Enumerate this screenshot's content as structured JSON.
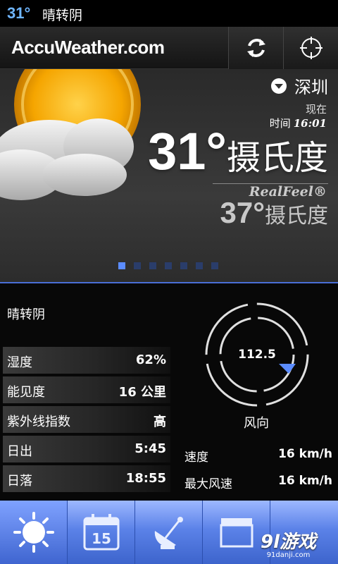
{
  "status_bar": {
    "temp": "31°",
    "condition": "晴转阴"
  },
  "header": {
    "logo": "AccuWeather.com",
    "refresh_icon": "refresh-icon",
    "locate_icon": "crosshair-icon"
  },
  "hero": {
    "location": "深圳",
    "now_label": "现在",
    "time_label": "时间",
    "time": "16:01",
    "temp": "31°",
    "temp_unit": "摄氏度",
    "realfeel_label": "RealFeel®",
    "realfeel_temp": "37°",
    "realfeel_unit": "摄氏度",
    "page_count": 7,
    "page_active": 0
  },
  "details": {
    "condition": "晴转阴",
    "stats": [
      {
        "label": "湿度",
        "value": "62%"
      },
      {
        "label": "能见度",
        "value": "16 公里"
      },
      {
        "label": "紫外线指数",
        "value": "高"
      },
      {
        "label": "日出",
        "value": "5:45"
      },
      {
        "label": "日落",
        "value": "18:55"
      }
    ],
    "wind": {
      "direction_deg": "112.5",
      "direction_label": "风向",
      "speed_label": "速度",
      "speed": "16 km/h",
      "max_label": "最大风速",
      "max": "16 km/h"
    }
  },
  "tabs": [
    {
      "icon": "sun-icon"
    },
    {
      "icon": "calendar-icon",
      "text": "15"
    },
    {
      "icon": "satellite-dish-icon"
    },
    {
      "icon": "video-icon"
    },
    {
      "icon": "more-icon"
    }
  ],
  "watermark": {
    "main": "9l游戏",
    "sub": "91danji.com"
  },
  "colors": {
    "accent": "#5b8cff",
    "status_temp": "#6fb6ff",
    "tab_bar": "#5b82e8"
  }
}
